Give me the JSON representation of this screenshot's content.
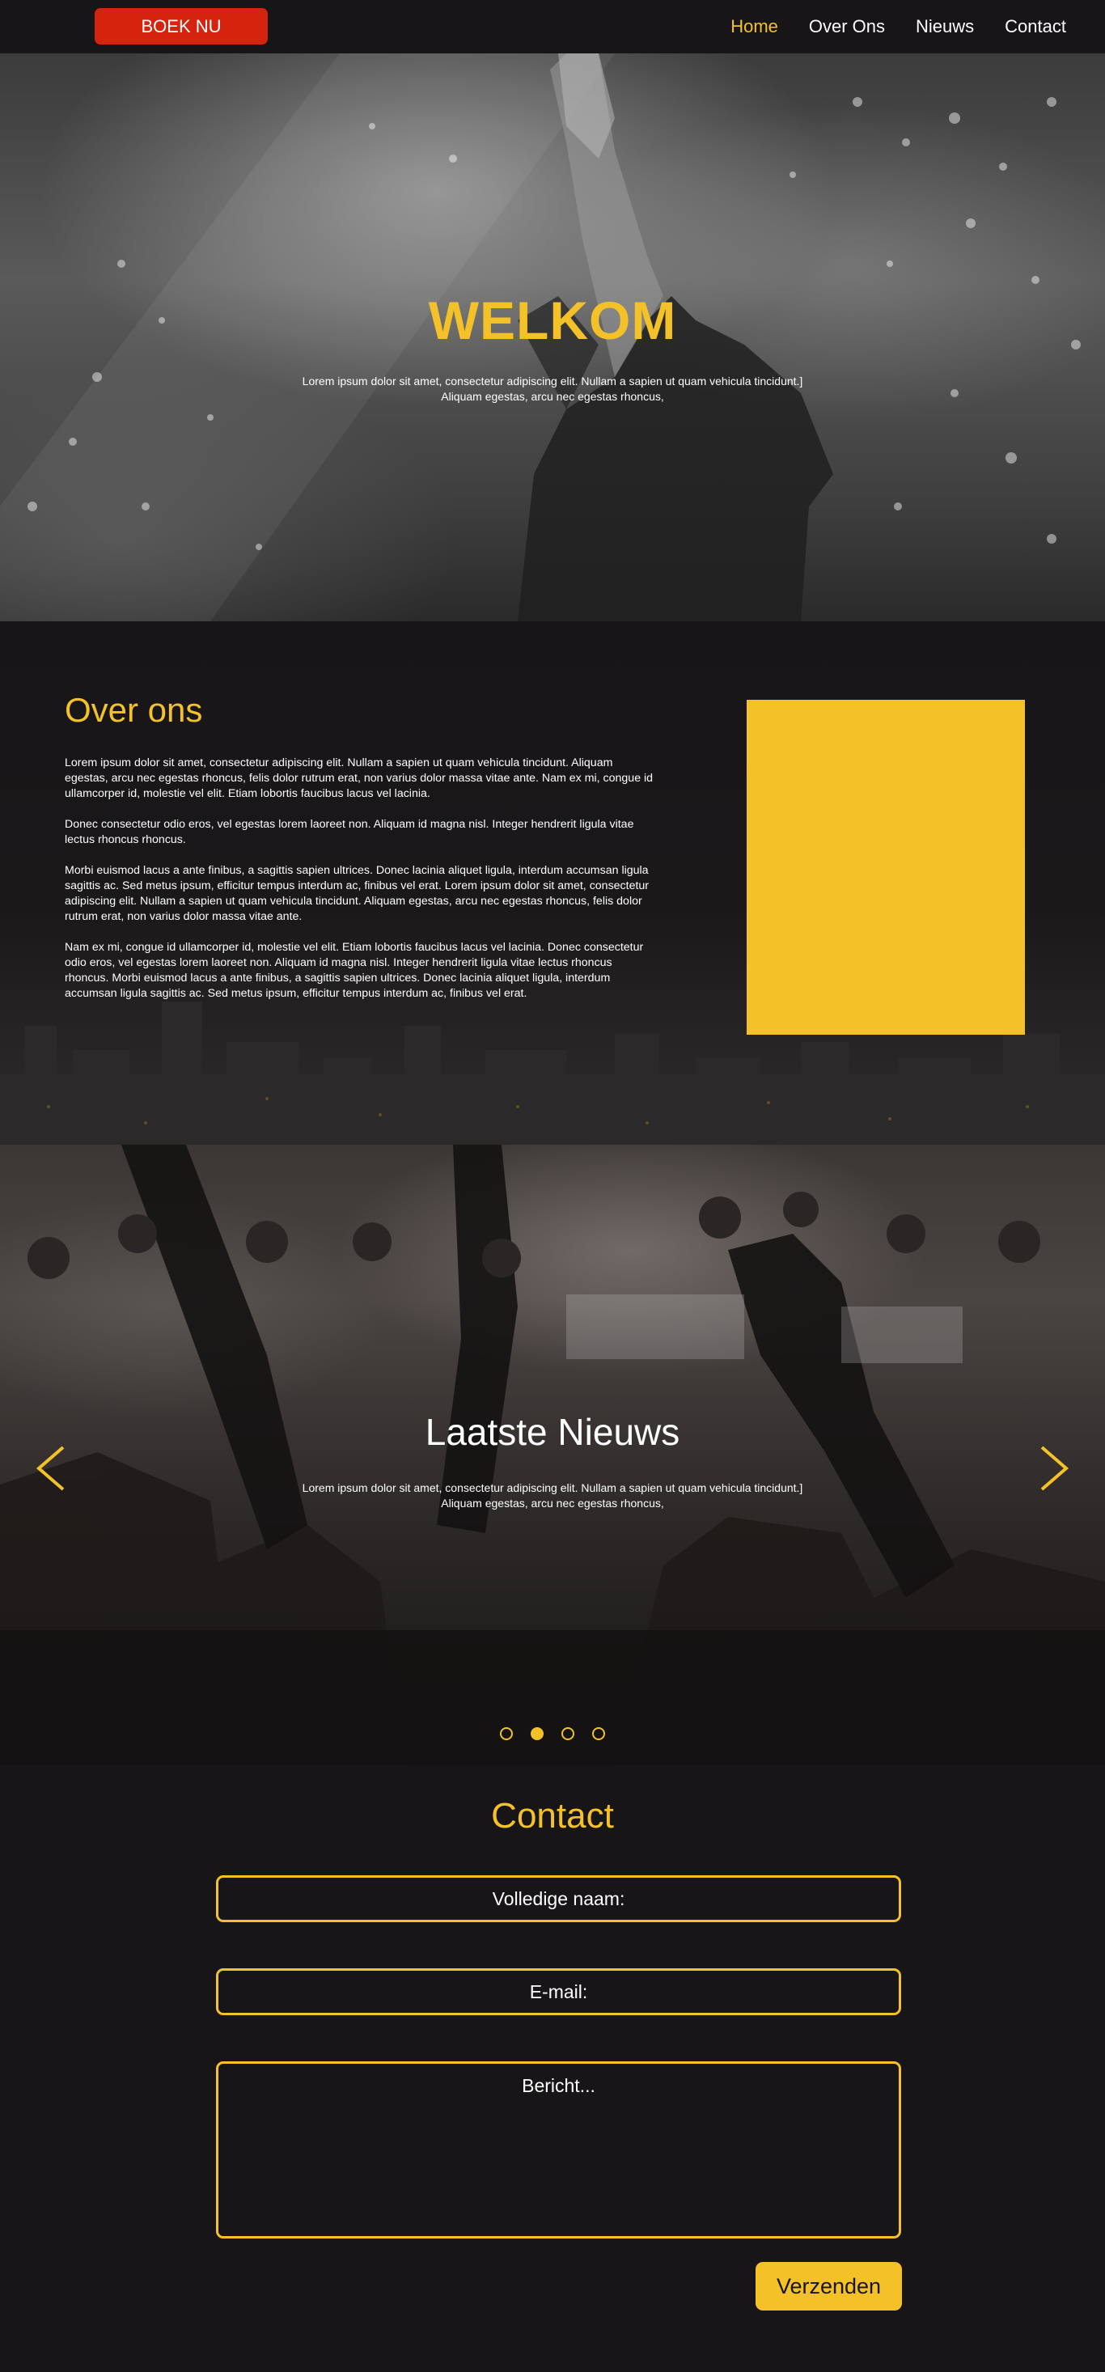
{
  "nav": {
    "book_label": "BOEK NU",
    "links": [
      {
        "label": "Home",
        "active": true
      },
      {
        "label": "Over Ons",
        "active": false
      },
      {
        "label": "Nieuws",
        "active": false
      },
      {
        "label": "Contact",
        "active": false
      }
    ]
  },
  "hero": {
    "title": "WELKOM",
    "text": "Lorem ipsum dolor sit amet, consectetur adipiscing elit. Nullam a sapien ut quam vehicula tincidunt.] Aliquam egestas, arcu nec egestas rhoncus,"
  },
  "about": {
    "title": "Over ons",
    "paragraphs": [
      "Lorem ipsum dolor sit amet, consectetur adipiscing elit. Nullam a sapien ut quam vehicula tincidunt. Aliquam egestas, arcu nec egestas rhoncus, felis dolor rutrum erat, non varius dolor massa vitae ante. Nam ex mi, congue id ullamcorper id, molestie vel elit. Etiam lobortis faucibus lacus vel lacinia.",
      "Donec consectetur odio eros, vel egestas lorem laoreet non. Aliquam id magna nisl. Integer hendrerit ligula vitae lectus rhoncus rhoncus.",
      "Morbi euismod lacus a ante finibus, a sagittis sapien ultrices. Donec lacinia aliquet ligula, interdum accumsan ligula sagittis ac. Sed metus ipsum, efficitur tempus interdum ac, finibus vel erat. Lorem ipsum dolor sit amet, consectetur adipiscing elit. Nullam a sapien ut quam vehicula tincidunt. Aliquam egestas, arcu nec egestas rhoncus, felis dolor rutrum erat, non varius dolor massa vitae ante.",
      "Nam ex mi, congue id ullamcorper id, molestie vel elit. Etiam lobortis faucibus lacus vel lacinia. Donec consectetur odio eros, vel egestas lorem laoreet non. Aliquam id magna nisl. Integer hendrerit ligula vitae lectus rhoncus rhoncus. Morbi euismod lacus a ante finibus, a sagittis sapien ultrices. Donec lacinia aliquet ligula, interdum accumsan ligula sagittis ac. Sed metus ipsum, efficitur tempus interdum ac, finibus vel erat."
    ]
  },
  "news": {
    "title": "Laatste Nieuws",
    "text": "Lorem ipsum dolor sit amet, consectetur adipiscing elit. Nullam a sapien ut quam vehicula tincidunt.] Aliquam egestas, arcu nec egestas rhoncus,",
    "slides": 4,
    "active_slide": 2,
    "prev_icon": "chevron-left-icon",
    "next_icon": "chevron-right-icon"
  },
  "contact": {
    "title": "Contact",
    "name_placeholder": "Volledige naam:",
    "email_placeholder": "E-mail:",
    "message_placeholder": "Bericht...",
    "submit_label": "Verzenden"
  },
  "colors": {
    "accent": "#f4c228",
    "book_button": "#d5230d",
    "background": "#171518"
  }
}
